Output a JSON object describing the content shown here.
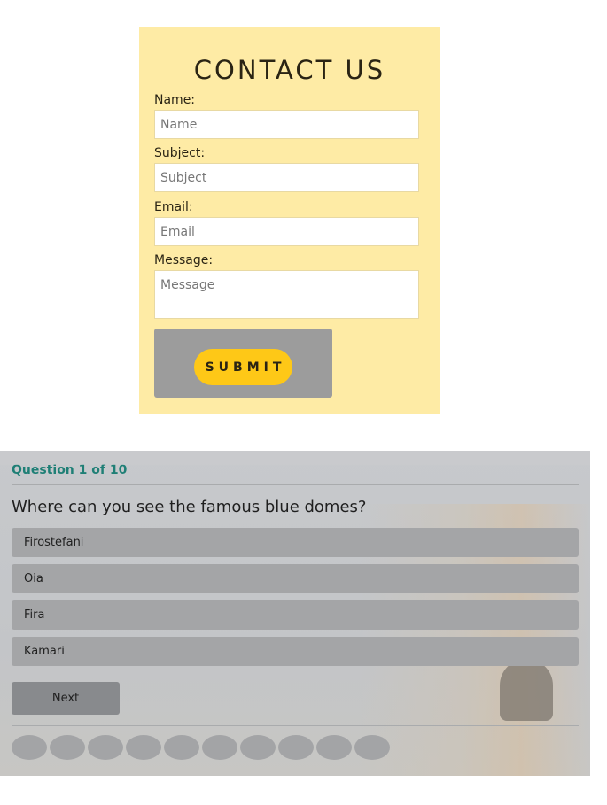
{
  "contact": {
    "title": "CONTACT US",
    "fields": [
      {
        "label": "Name:",
        "placeholder": "Name"
      },
      {
        "label": "Subject:",
        "placeholder": "Subject"
      },
      {
        "label": "Email:",
        "placeholder": "Email"
      },
      {
        "label": "Message:",
        "placeholder": "Message"
      }
    ],
    "submit_label": "SUBMIT"
  },
  "quiz": {
    "counter": "Question 1 of 10",
    "question": "Where can you see the famous blue domes?",
    "options": [
      "Firostefani",
      "Oia",
      "Fira",
      "Kamari"
    ],
    "next_label": "Next",
    "progress_total": 10,
    "progress_current": 1
  },
  "colors": {
    "card_bg": "#feeba5",
    "submit_bg": "#fec817",
    "accent_teal": "#1f7f76"
  }
}
